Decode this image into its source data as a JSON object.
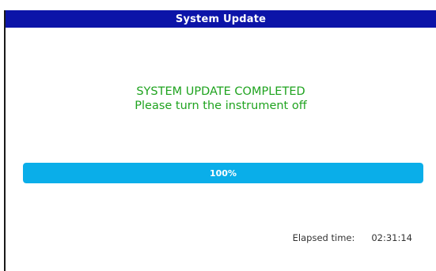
{
  "window": {
    "title": "System Update"
  },
  "status": {
    "line1": "SYSTEM UPDATE COMPLETED",
    "line2": "Please turn the instrument off",
    "color": "#1fa31f"
  },
  "progress": {
    "value": 100,
    "label": "100%",
    "fill_color": "#0aaee9"
  },
  "elapsed": {
    "label": "Elapsed time:",
    "value": "02:31:14"
  },
  "colors": {
    "titlebar": "#0c14a8"
  }
}
